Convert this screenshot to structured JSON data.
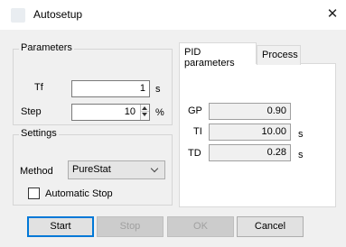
{
  "window": {
    "title": "Autosetup",
    "close_glyph": "✕"
  },
  "parameters": {
    "group_label": "Parameters",
    "tf": {
      "label": "Tf",
      "value": "1",
      "unit": "s"
    },
    "step": {
      "label": "Step",
      "value": "10",
      "unit": "%"
    }
  },
  "settings": {
    "group_label": "Settings",
    "method": {
      "label": "Method",
      "value": "PureStat"
    },
    "automatic_stop": {
      "label": "Automatic Stop",
      "checked": false
    }
  },
  "tabs": {
    "pid": "PID parameters",
    "process": "Process"
  },
  "pid": {
    "gp": {
      "label": "GP",
      "value": "0.90",
      "unit": ""
    },
    "ti": {
      "label": "TI",
      "value": "10.00",
      "unit": "s"
    },
    "td": {
      "label": "TD",
      "value": "0.28",
      "unit": "s"
    }
  },
  "buttons": {
    "start": "Start",
    "stop": "Stop",
    "ok": "OK",
    "cancel": "Cancel"
  },
  "icons": {
    "app": "app-icon",
    "close": "close-icon",
    "spinner": "spinner-icon",
    "dropdown": "chevron-down-icon"
  }
}
